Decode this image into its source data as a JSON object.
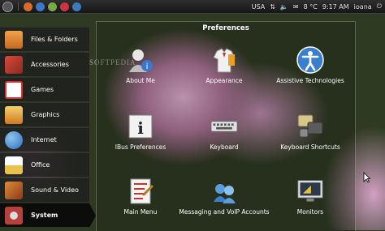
{
  "top_panel": {
    "keyboard_layout": "USA",
    "volume_icon": "speaker-icon",
    "weather": "8 °C",
    "time": "9:17 AM",
    "user": "ioana"
  },
  "categories": [
    {
      "label": "Files & Folders",
      "icon": "folder-icon",
      "color": "#d8762a"
    },
    {
      "label": "Accessories",
      "icon": "tools-icon",
      "color": "#c83a2a"
    },
    {
      "label": "Games",
      "icon": "cards-icon",
      "color": "#d6342f"
    },
    {
      "label": "Graphics",
      "icon": "brush-icon",
      "color": "#e49a2c"
    },
    {
      "label": "Internet",
      "icon": "globe-icon",
      "color": "#3d87c9"
    },
    {
      "label": "Office",
      "icon": "document-icon",
      "color": "#e8c24a"
    },
    {
      "label": "Sound & Video",
      "icon": "media-icon",
      "color": "#c56528"
    },
    {
      "label": "System",
      "icon": "system-icon",
      "color": "#b5413a"
    }
  ],
  "main": {
    "title": "Preferences",
    "items": [
      {
        "label": "About Me",
        "icon": "about-me-icon"
      },
      {
        "label": "Appearance",
        "icon": "appearance-icon"
      },
      {
        "label": "Assistive Technologies",
        "icon": "accessibility-icon"
      },
      {
        "label": "IBus Preferences",
        "icon": "info-icon"
      },
      {
        "label": "Keyboard",
        "icon": "keyboard-icon"
      },
      {
        "label": "Keyboard Shortcuts",
        "icon": "keyboard-shortcuts-icon"
      },
      {
        "label": "Main Menu",
        "icon": "main-menu-icon"
      },
      {
        "label": "Messaging and VoIP Accounts",
        "icon": "messaging-icon"
      },
      {
        "label": "Monitors",
        "icon": "monitor-icon"
      }
    ]
  },
  "watermark": "SOFTPEDIA"
}
